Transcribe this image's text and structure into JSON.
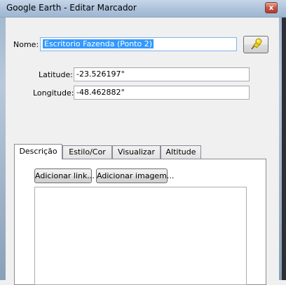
{
  "window": {
    "title": "Google Earth - Editar Marcador",
    "close_glyph": "x"
  },
  "form": {
    "name_label": "Nome:",
    "name_value": "Escritorio Fazenda (Ponto 2)",
    "latitude_label": "Latitude:",
    "latitude_value": "-23.526197°",
    "longitude_label": "Longitude:",
    "longitude_value": "-48.462882°",
    "pin_icon": "yellow-pushpin-icon"
  },
  "tabs": [
    {
      "label": "Descrição",
      "active": true
    },
    {
      "label": "Estilo/Cor",
      "active": false
    },
    {
      "label": "Visualizar",
      "active": false
    },
    {
      "label": "Altitude",
      "active": false
    }
  ],
  "description": {
    "add_link_label": "Adicionar link...",
    "add_image_label": "Adicionar imagem...",
    "text": ""
  },
  "colors": {
    "selection": "#3399ff",
    "pin": "#f2d21b"
  }
}
